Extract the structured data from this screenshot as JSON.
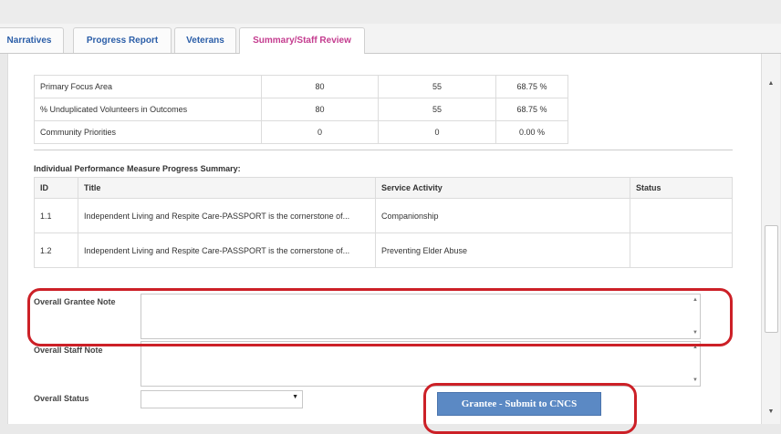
{
  "tabs": [
    {
      "label": "Narratives"
    },
    {
      "label": "Progress Report"
    },
    {
      "label": "Veterans"
    },
    {
      "label": "Summary/Staff Review",
      "active": true
    }
  ],
  "focus_rows": [
    {
      "name": "Primary Focus Area",
      "col1": "80",
      "col2": "55",
      "pct": "68.75 %"
    },
    {
      "name": "% Unduplicated Volunteers in Outcomes",
      "col1": "80",
      "col2": "55",
      "pct": "68.75 %"
    },
    {
      "name": "Community Priorities",
      "col1": "0",
      "col2": "0",
      "pct": "0.00 %"
    }
  ],
  "measures": {
    "title": "Individual Performance Measure Progress Summary:",
    "headers": {
      "id": "ID",
      "title": "Title",
      "activity": "Service Activity",
      "status": "Status"
    },
    "rows": [
      {
        "id": "1.1",
        "title": "Independent Living and Respite Care-PASSPORT is the cornerstone of...",
        "activity": "Companionship",
        "status": ""
      },
      {
        "id": "1.2",
        "title": "Independent Living and Respite Care-PASSPORT is the cornerstone of...",
        "activity": "Preventing Elder Abuse",
        "status": ""
      }
    ]
  },
  "form": {
    "grantee_note_label": "Overall Grantee Note",
    "grantee_note_value": "",
    "staff_note_label": "Overall Staff Note",
    "staff_note_value": "",
    "status_label": "Overall Status",
    "status_value": ""
  },
  "submit_label": "Grantee - Submit to CNCS",
  "colors": {
    "callout": "#cc2027",
    "active_tab": "#c43c8f",
    "tab_text": "#2b5ea8",
    "button": "#5b89c4"
  }
}
